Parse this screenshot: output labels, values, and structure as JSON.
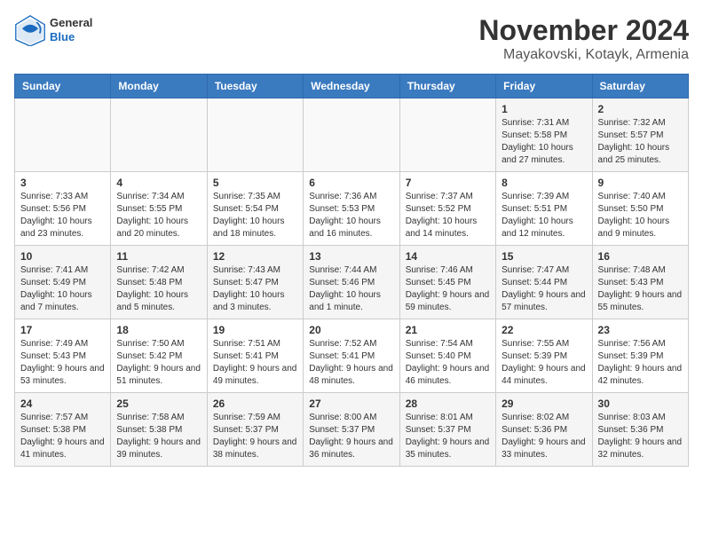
{
  "header": {
    "logo": {
      "general": "General",
      "blue": "Blue"
    },
    "title": "November 2024",
    "location": "Mayakovski, Kotayk, Armenia"
  },
  "calendar": {
    "days_of_week": [
      "Sunday",
      "Monday",
      "Tuesday",
      "Wednesday",
      "Thursday",
      "Friday",
      "Saturday"
    ],
    "weeks": [
      [
        {
          "day": "",
          "info": ""
        },
        {
          "day": "",
          "info": ""
        },
        {
          "day": "",
          "info": ""
        },
        {
          "day": "",
          "info": ""
        },
        {
          "day": "",
          "info": ""
        },
        {
          "day": "1",
          "info": "Sunrise: 7:31 AM\nSunset: 5:58 PM\nDaylight: 10 hours and 27 minutes."
        },
        {
          "day": "2",
          "info": "Sunrise: 7:32 AM\nSunset: 5:57 PM\nDaylight: 10 hours and 25 minutes."
        }
      ],
      [
        {
          "day": "3",
          "info": "Sunrise: 7:33 AM\nSunset: 5:56 PM\nDaylight: 10 hours and 23 minutes."
        },
        {
          "day": "4",
          "info": "Sunrise: 7:34 AM\nSunset: 5:55 PM\nDaylight: 10 hours and 20 minutes."
        },
        {
          "day": "5",
          "info": "Sunrise: 7:35 AM\nSunset: 5:54 PM\nDaylight: 10 hours and 18 minutes."
        },
        {
          "day": "6",
          "info": "Sunrise: 7:36 AM\nSunset: 5:53 PM\nDaylight: 10 hours and 16 minutes."
        },
        {
          "day": "7",
          "info": "Sunrise: 7:37 AM\nSunset: 5:52 PM\nDaylight: 10 hours and 14 minutes."
        },
        {
          "day": "8",
          "info": "Sunrise: 7:39 AM\nSunset: 5:51 PM\nDaylight: 10 hours and 12 minutes."
        },
        {
          "day": "9",
          "info": "Sunrise: 7:40 AM\nSunset: 5:50 PM\nDaylight: 10 hours and 9 minutes."
        }
      ],
      [
        {
          "day": "10",
          "info": "Sunrise: 7:41 AM\nSunset: 5:49 PM\nDaylight: 10 hours and 7 minutes."
        },
        {
          "day": "11",
          "info": "Sunrise: 7:42 AM\nSunset: 5:48 PM\nDaylight: 10 hours and 5 minutes."
        },
        {
          "day": "12",
          "info": "Sunrise: 7:43 AM\nSunset: 5:47 PM\nDaylight: 10 hours and 3 minutes."
        },
        {
          "day": "13",
          "info": "Sunrise: 7:44 AM\nSunset: 5:46 PM\nDaylight: 10 hours and 1 minute."
        },
        {
          "day": "14",
          "info": "Sunrise: 7:46 AM\nSunset: 5:45 PM\nDaylight: 9 hours and 59 minutes."
        },
        {
          "day": "15",
          "info": "Sunrise: 7:47 AM\nSunset: 5:44 PM\nDaylight: 9 hours and 57 minutes."
        },
        {
          "day": "16",
          "info": "Sunrise: 7:48 AM\nSunset: 5:43 PM\nDaylight: 9 hours and 55 minutes."
        }
      ],
      [
        {
          "day": "17",
          "info": "Sunrise: 7:49 AM\nSunset: 5:43 PM\nDaylight: 9 hours and 53 minutes."
        },
        {
          "day": "18",
          "info": "Sunrise: 7:50 AM\nSunset: 5:42 PM\nDaylight: 9 hours and 51 minutes."
        },
        {
          "day": "19",
          "info": "Sunrise: 7:51 AM\nSunset: 5:41 PM\nDaylight: 9 hours and 49 minutes."
        },
        {
          "day": "20",
          "info": "Sunrise: 7:52 AM\nSunset: 5:41 PM\nDaylight: 9 hours and 48 minutes."
        },
        {
          "day": "21",
          "info": "Sunrise: 7:54 AM\nSunset: 5:40 PM\nDaylight: 9 hours and 46 minutes."
        },
        {
          "day": "22",
          "info": "Sunrise: 7:55 AM\nSunset: 5:39 PM\nDaylight: 9 hours and 44 minutes."
        },
        {
          "day": "23",
          "info": "Sunrise: 7:56 AM\nSunset: 5:39 PM\nDaylight: 9 hours and 42 minutes."
        }
      ],
      [
        {
          "day": "24",
          "info": "Sunrise: 7:57 AM\nSunset: 5:38 PM\nDaylight: 9 hours and 41 minutes."
        },
        {
          "day": "25",
          "info": "Sunrise: 7:58 AM\nSunset: 5:38 PM\nDaylight: 9 hours and 39 minutes."
        },
        {
          "day": "26",
          "info": "Sunrise: 7:59 AM\nSunset: 5:37 PM\nDaylight: 9 hours and 38 minutes."
        },
        {
          "day": "27",
          "info": "Sunrise: 8:00 AM\nSunset: 5:37 PM\nDaylight: 9 hours and 36 minutes."
        },
        {
          "day": "28",
          "info": "Sunrise: 8:01 AM\nSunset: 5:37 PM\nDaylight: 9 hours and 35 minutes."
        },
        {
          "day": "29",
          "info": "Sunrise: 8:02 AM\nSunset: 5:36 PM\nDaylight: 9 hours and 33 minutes."
        },
        {
          "day": "30",
          "info": "Sunrise: 8:03 AM\nSunset: 5:36 PM\nDaylight: 9 hours and 32 minutes."
        }
      ]
    ]
  }
}
